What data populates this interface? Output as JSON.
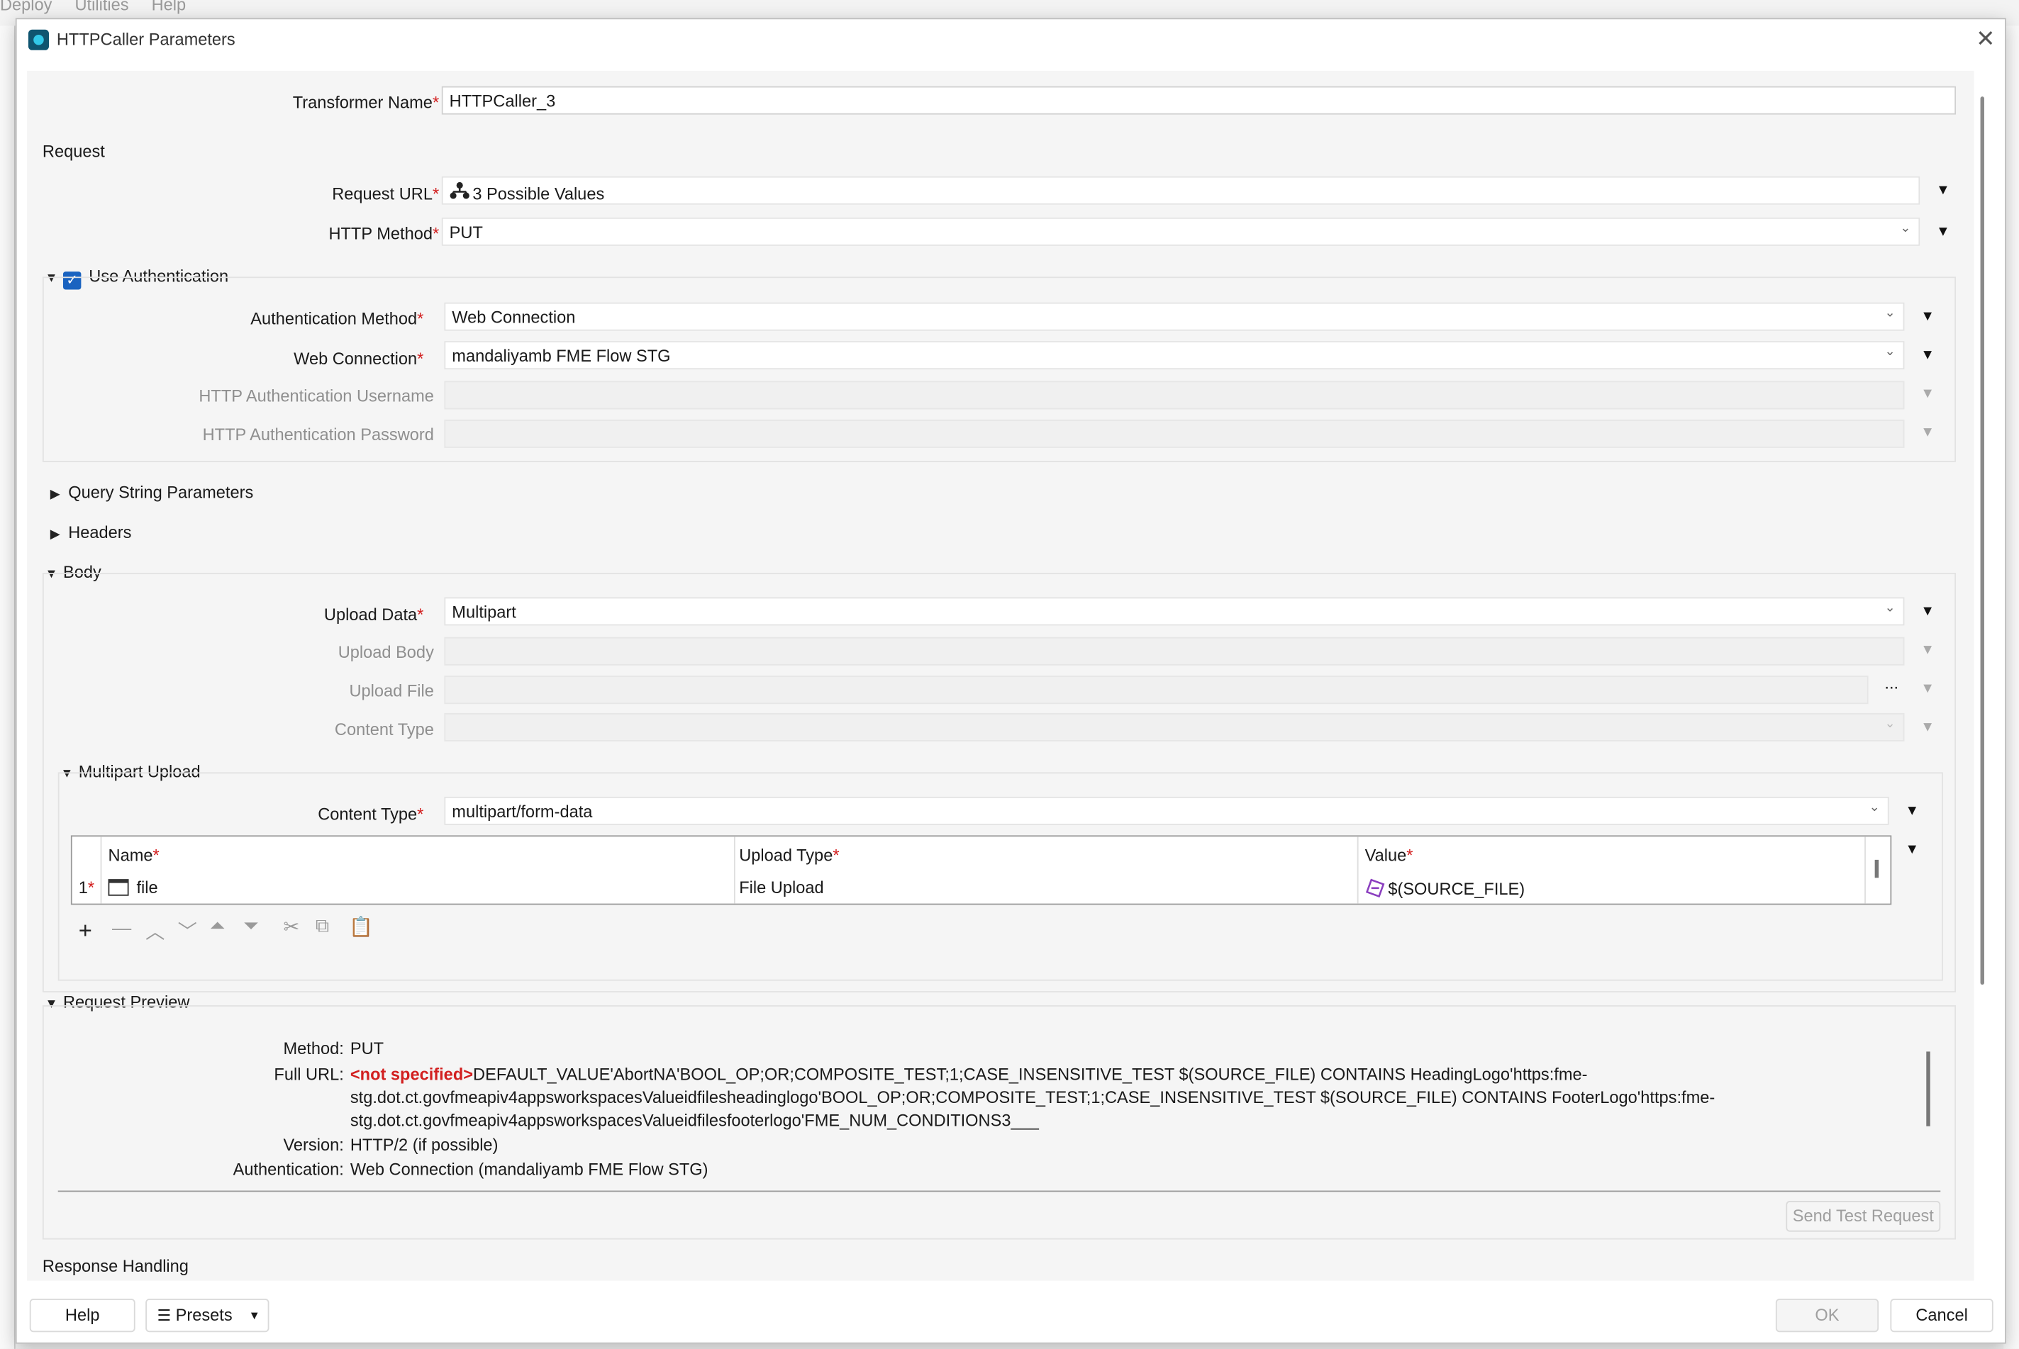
{
  "background": {
    "menu": [
      "Deploy",
      "Utilities",
      "Help"
    ]
  },
  "dialog": {
    "title": "HTTPCaller Parameters",
    "close_glyph": "✕"
  },
  "transformer": {
    "label": "Transformer Name",
    "value": "HTTPCaller_3"
  },
  "request": {
    "section": "Request",
    "url": {
      "label": "Request URL",
      "value": "3 Possible Values",
      "icon": "hierarchy-icon"
    },
    "method": {
      "label": "HTTP Method",
      "value": "PUT"
    }
  },
  "auth": {
    "section": "Use Authentication",
    "checked": true,
    "method": {
      "label": "Authentication Method",
      "value": "Web Connection"
    },
    "connection": {
      "label": "Web Connection",
      "value": "mandaliyamb FME Flow STG"
    },
    "username": {
      "label": "HTTP Authentication Username",
      "value": ""
    },
    "password": {
      "label": "HTTP Authentication Password",
      "value": ""
    }
  },
  "query_section": "Query String Parameters",
  "headers_section": "Headers",
  "body": {
    "section": "Body",
    "upload_data": {
      "label": "Upload Data",
      "value": "Multipart"
    },
    "upload_body": {
      "label": "Upload Body",
      "value": ""
    },
    "upload_file": {
      "label": "Upload File",
      "value": "",
      "browse": "..."
    },
    "content_type": {
      "label": "Content Type",
      "value": ""
    }
  },
  "multipart": {
    "section": "Multipart Upload",
    "content_type": {
      "label": "Content Type",
      "value": "multipart/form-data"
    },
    "columns": [
      "Name",
      "Upload Type",
      "Value"
    ],
    "rows": [
      {
        "index": "1",
        "name": "file",
        "upload_type": "File Upload",
        "value": "$(SOURCE_FILE)"
      }
    ]
  },
  "preview": {
    "section": "Request Preview",
    "method": {
      "key": "Method:",
      "value": "PUT"
    },
    "full_url": {
      "key": "Full URL:",
      "not_specified": "<not specified>",
      "line1": "DEFAULT_VALUE'AbortNA'BOOL_OP;OR;COMPOSITE_TEST;1;CASE_INSENSITIVE_TEST $(SOURCE_FILE) CONTAINS HeadingLogo'https:fme-",
      "line2": "stg.dot.ct.govfmeapiv4appsworkspacesValueidfilesheadinglogo'BOOL_OP;OR;COMPOSITE_TEST;1;CASE_INSENSITIVE_TEST $(SOURCE_FILE) CONTAINS FooterLogo'https:fme-",
      "line3": "stg.dot.ct.govfmeapiv4appsworkspacesValueidfilesfooterlogo'FME_NUM_CONDITIONS3___"
    },
    "version": {
      "key": "Version:",
      "value": "HTTP/2 (if possible)"
    },
    "authentication": {
      "key": "Authentication:",
      "value": "Web Connection (mandaliyamb FME Flow STG)"
    },
    "send_button": "Send Test Request"
  },
  "response_section": "Response Handling",
  "footer": {
    "help": "Help",
    "presets": "Presets",
    "ok": "OK",
    "cancel": "Cancel"
  }
}
